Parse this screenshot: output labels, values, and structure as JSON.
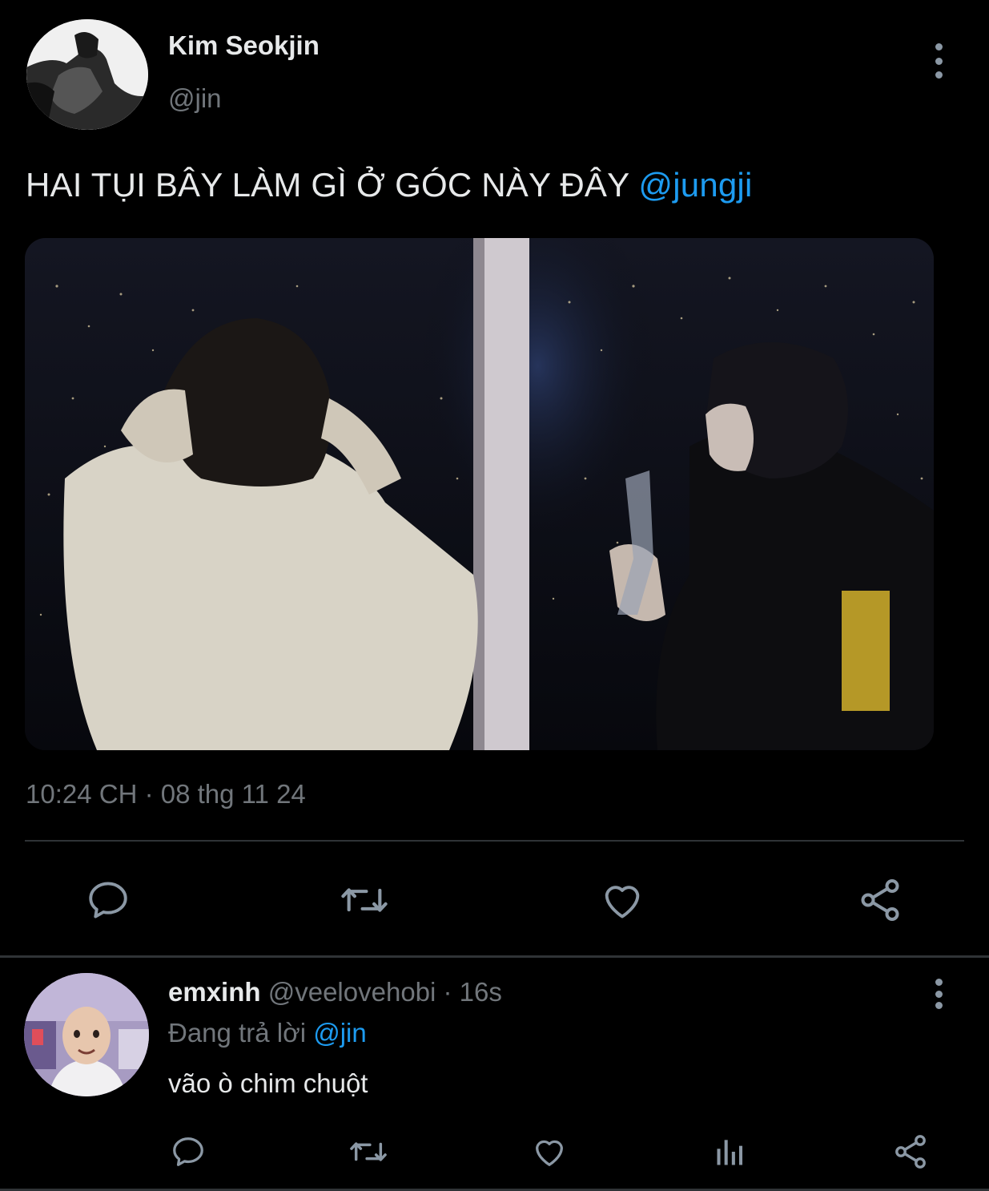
{
  "tweet": {
    "author_name": "Kim Seokjin",
    "author_handle": "@jin",
    "text": "HAI TỤI BÂY LÀM GÌ Ở GÓC NÀY ĐÂY ",
    "mention": "@jungji",
    "timestamp": "10:24 CH · 08 thg 11 24",
    "actions": {
      "reply_icon": "comment-icon",
      "retweet_icon": "retweet-icon",
      "like_icon": "heart-icon",
      "share_icon": "share-icon"
    }
  },
  "reply": {
    "author_name": "emxinh",
    "author_handle": "@veelovehobi",
    "time": " · 16s",
    "replying_prefix": "Đang trả lời ",
    "replying_to": "@jin",
    "text": "vão ò chim chuột",
    "actions": {
      "reply_icon": "comment-icon",
      "retweet_icon": "retweet-icon",
      "like_icon": "heart-icon",
      "views_icon": "analytics-icon",
      "share_icon": "share-icon"
    }
  },
  "colors": {
    "background": "#000000",
    "text_primary": "#e7e9ea",
    "text_secondary": "#71767b",
    "accent": "#1d9bf0",
    "divider": "#2f3336",
    "icon": "#8b98a5"
  }
}
